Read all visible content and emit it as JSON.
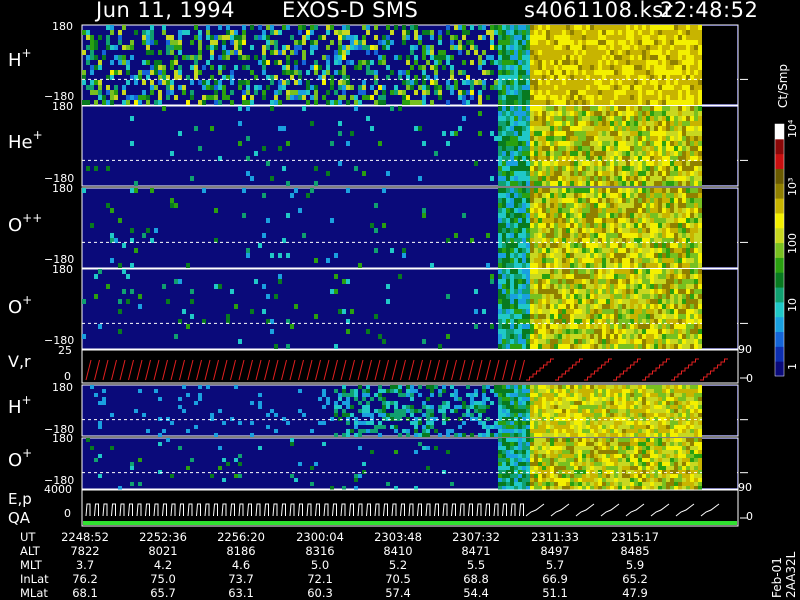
{
  "header": {
    "date": "Jun 11, 1994",
    "instrument": "EXOS-D SMS",
    "file": "s4061108.ksr",
    "time": "22:48:52"
  },
  "panel_labels": {
    "p1_base": "H",
    "p1_sup": "+",
    "p2_base": "He",
    "p2_sup": "+",
    "p3_base": "O",
    "p3_sup": "++",
    "p4_base": "O",
    "p4_sup": "+",
    "p5": "V,r",
    "p6_base": "H",
    "p6_sup": "+",
    "p7_base": "O",
    "p7_sup": "+",
    "p8a": "E,p",
    "p8b": "QA"
  },
  "axis_ticks": {
    "angle_top": "180",
    "angle_bottom": "−180",
    "vr_top": "25",
    "vr_zero": "0",
    "vr_right_top": "90",
    "vr_right_zero": "0",
    "ep_top": "4000",
    "ep_zero": "0",
    "ep_right_top": "90",
    "ep_right_zero": "0"
  },
  "colorbar": {
    "unit": "Ct/Smp",
    "labels": [
      "1",
      "10",
      "100",
      "10³",
      "10⁴"
    ],
    "colors": [
      "#0a0a7a",
      "#0d2fb0",
      "#1565d8",
      "#1aa0e0",
      "#20c8c8",
      "#10a070",
      "#087a20",
      "#2aa010",
      "#78c020",
      "#c8d820",
      "#f4f000",
      "#c8b400",
      "#908000",
      "#6a5a00",
      "#c81010",
      "#8a0808",
      "#ffffff"
    ]
  },
  "footer_tag": "Feb-01 2AA32L",
  "table": {
    "row_labels": [
      "UT",
      "ALT",
      "MLT",
      "InLat",
      "MLat"
    ],
    "columns": [
      {
        "UT": "2248:52",
        "ALT": "7822",
        "MLT": "3.7",
        "InLat": "76.2",
        "MLat": "68.1"
      },
      {
        "UT": "2252:36",
        "ALT": "8021",
        "MLT": "4.2",
        "InLat": "75.0",
        "MLat": "65.7"
      },
      {
        "UT": "2256:20",
        "ALT": "8186",
        "MLT": "4.6",
        "InLat": "73.7",
        "MLat": "63.1"
      },
      {
        "UT": "2300:04",
        "ALT": "8316",
        "MLT": "5.0",
        "InLat": "72.1",
        "MLat": "60.3"
      },
      {
        "UT": "2303:48",
        "ALT": "8410",
        "MLT": "5.2",
        "InLat": "70.5",
        "MLat": "57.4"
      },
      {
        "UT": "2307:32",
        "ALT": "8471",
        "MLT": "5.5",
        "InLat": "68.8",
        "MLat": "54.4"
      },
      {
        "UT": "2311:33",
        "ALT": "8497",
        "MLT": "5.7",
        "InLat": "66.9",
        "MLat": "51.1"
      },
      {
        "UT": "2315:17",
        "ALT": "8485",
        "MLT": "5.9",
        "InLat": "65.2",
        "MLat": "47.9"
      }
    ]
  },
  "chart_data": [
    {
      "type": "heatmap",
      "title": "H+",
      "ylim": [
        -180,
        180
      ],
      "zlabel": "Ct/Smp",
      "zscale": "log",
      "zlim": [
        1,
        10000
      ]
    },
    {
      "type": "heatmap",
      "title": "He+",
      "ylim": [
        -180,
        180
      ]
    },
    {
      "type": "heatmap",
      "title": "O++",
      "ylim": [
        -180,
        180
      ]
    },
    {
      "type": "heatmap",
      "title": "O+",
      "ylim": [
        -180,
        180
      ]
    },
    {
      "type": "line",
      "title": "V,r",
      "ylim": [
        0,
        25
      ],
      "y2lim": [
        0,
        90
      ]
    },
    {
      "type": "heatmap",
      "title": "H+",
      "ylim": [
        -180,
        180
      ]
    },
    {
      "type": "heatmap",
      "title": "O+",
      "ylim": [
        -180,
        180
      ]
    },
    {
      "type": "line",
      "title": "E,p QA",
      "ylim": [
        0,
        4000
      ],
      "y2lim": [
        0,
        90
      ]
    }
  ]
}
